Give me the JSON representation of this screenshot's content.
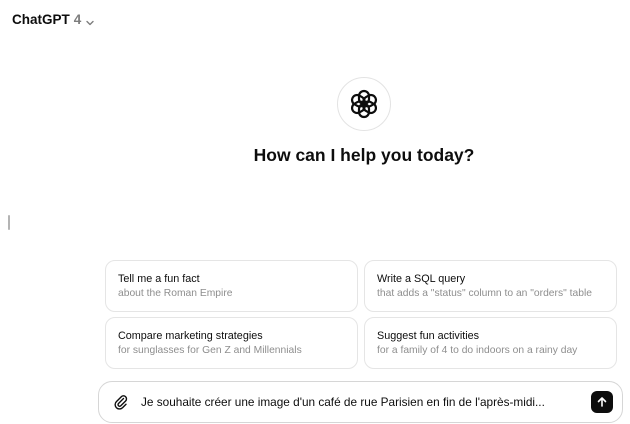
{
  "header": {
    "model_name": "ChatGPT",
    "model_version": "4",
    "dropdown_icon": "chevron-down-icon"
  },
  "main": {
    "logo_icon": "openai-logo-icon",
    "headline": "How can I help you today?"
  },
  "suggestions": [
    {
      "title": "Tell me a fun fact",
      "subtitle": "about the Roman Empire"
    },
    {
      "title": "Write a SQL query",
      "subtitle": "that adds a \"status\" column to an \"orders\" table"
    },
    {
      "title": "Compare marketing strategies",
      "subtitle": "for sunglasses for Gen Z and Millennials"
    },
    {
      "title": "Suggest fun activities",
      "subtitle": "for a family of 4 to do indoors on a rainy day"
    }
  ],
  "composer": {
    "value": "Je souhaite créer une image d'un café de rue Parisien en fin de l'après-midi...",
    "attach_icon": "paperclip-icon",
    "send_icon": "arrow-up-icon"
  },
  "colors": {
    "text": "#0d0d0d",
    "muted": "#8e8e8e",
    "border": "#e5e5e5",
    "send_button": "#0d0d0d",
    "spellcheck": "#e0424a"
  }
}
